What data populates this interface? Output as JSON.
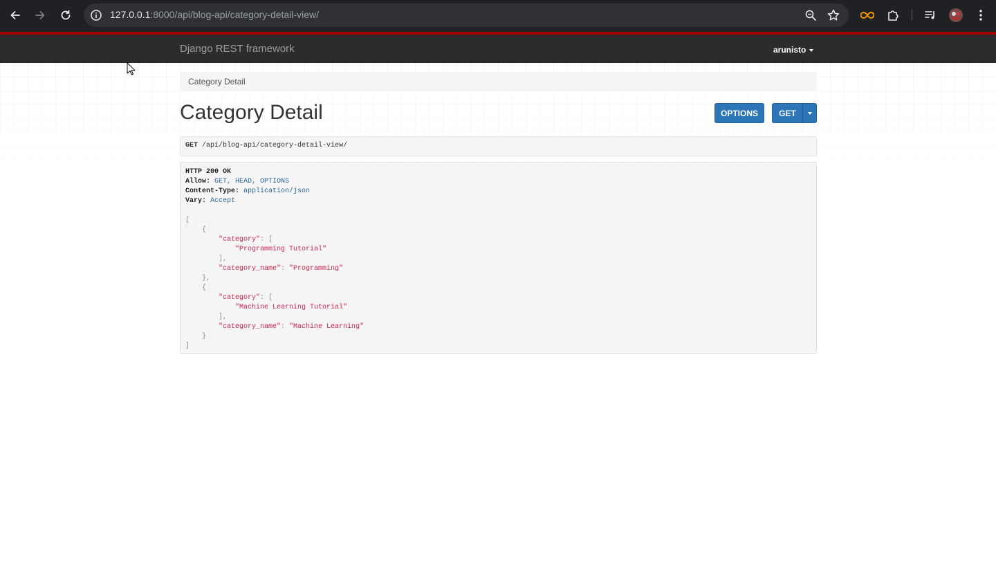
{
  "browser": {
    "url_host": "127.0.0.1",
    "url_rest": ":8000/api/blog-api/category-detail-view/"
  },
  "navbar": {
    "brand": "Django REST framework",
    "user": "arunisto"
  },
  "breadcrumb": {
    "label": "Category Detail"
  },
  "page": {
    "title": "Category Detail",
    "options_button": "OPTIONS",
    "get_button": "GET"
  },
  "request": {
    "method": "GET",
    "path": "/api/blog-api/category-detail-view/"
  },
  "response": {
    "status": "HTTP 200 OK",
    "headers": [
      {
        "key": "Allow:",
        "value": "GET, HEAD, OPTIONS"
      },
      {
        "key": "Content-Type:",
        "value": "application/json"
      },
      {
        "key": "Vary:",
        "value": "Accept"
      }
    ],
    "body": [
      {
        "category_key": "\"category\"",
        "category_value": "\"Programming Tutorial\"",
        "name_key": "\"category_name\"",
        "name_value": "\"Programming\""
      },
      {
        "category_key": "\"category\"",
        "category_value": "\"Machine Learning Tutorial\"",
        "name_key": "\"category_name\"",
        "name_value": "\"Machine Learning\""
      }
    ]
  },
  "colors": {
    "chrome_bg": "#202124",
    "navbar_bg": "#2c2c2c",
    "navbar_accent": "#a30000",
    "button_blue": "#2c75b6",
    "json_string": "#c7254e",
    "header_value": "#2a6496"
  }
}
